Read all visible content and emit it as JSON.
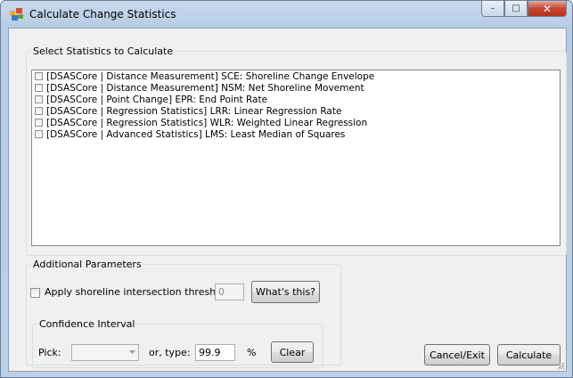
{
  "window": {
    "title": "Calculate Change Statistics",
    "caption_buttons": {
      "minimize": "–",
      "maximize": "□",
      "close": "✕"
    }
  },
  "statistics_group": {
    "legend": "Select Statistics to Calculate",
    "items": [
      {
        "label": "[DSASCore | Distance Measurement] SCE: Shoreline Change Envelope",
        "checked": false
      },
      {
        "label": "[DSASCore | Distance Measurement] NSM: Net Shoreline Movement",
        "checked": false
      },
      {
        "label": "[DSASCore | Point Change] EPR: End Point Rate",
        "checked": false
      },
      {
        "label": "[DSASCore | Regression Statistics] LRR: Linear Regression Rate",
        "checked": false
      },
      {
        "label": "[DSASCore | Regression Statistics] WLR: Weighted Linear Regression",
        "checked": false
      },
      {
        "label": "[DSASCore | Advanced Statistics] LMS: Least Median of Squares",
        "checked": false
      }
    ]
  },
  "additional_parameters": {
    "legend": "Additional Parameters",
    "threshold_label": "Apply shoreline intersection threshold:",
    "threshold_checked": false,
    "threshold_value": "0",
    "whats_this_label": "What's this?",
    "confidence": {
      "legend": "Confidence Interval",
      "pick_label": "Pick:",
      "pick_value": "",
      "or_type_label": "or, type:",
      "type_value": "99.9",
      "percent_label": "%",
      "clear_label": "Clear"
    }
  },
  "footer": {
    "cancel_label": "Cancel/Exit",
    "calculate_label": "Calculate"
  }
}
